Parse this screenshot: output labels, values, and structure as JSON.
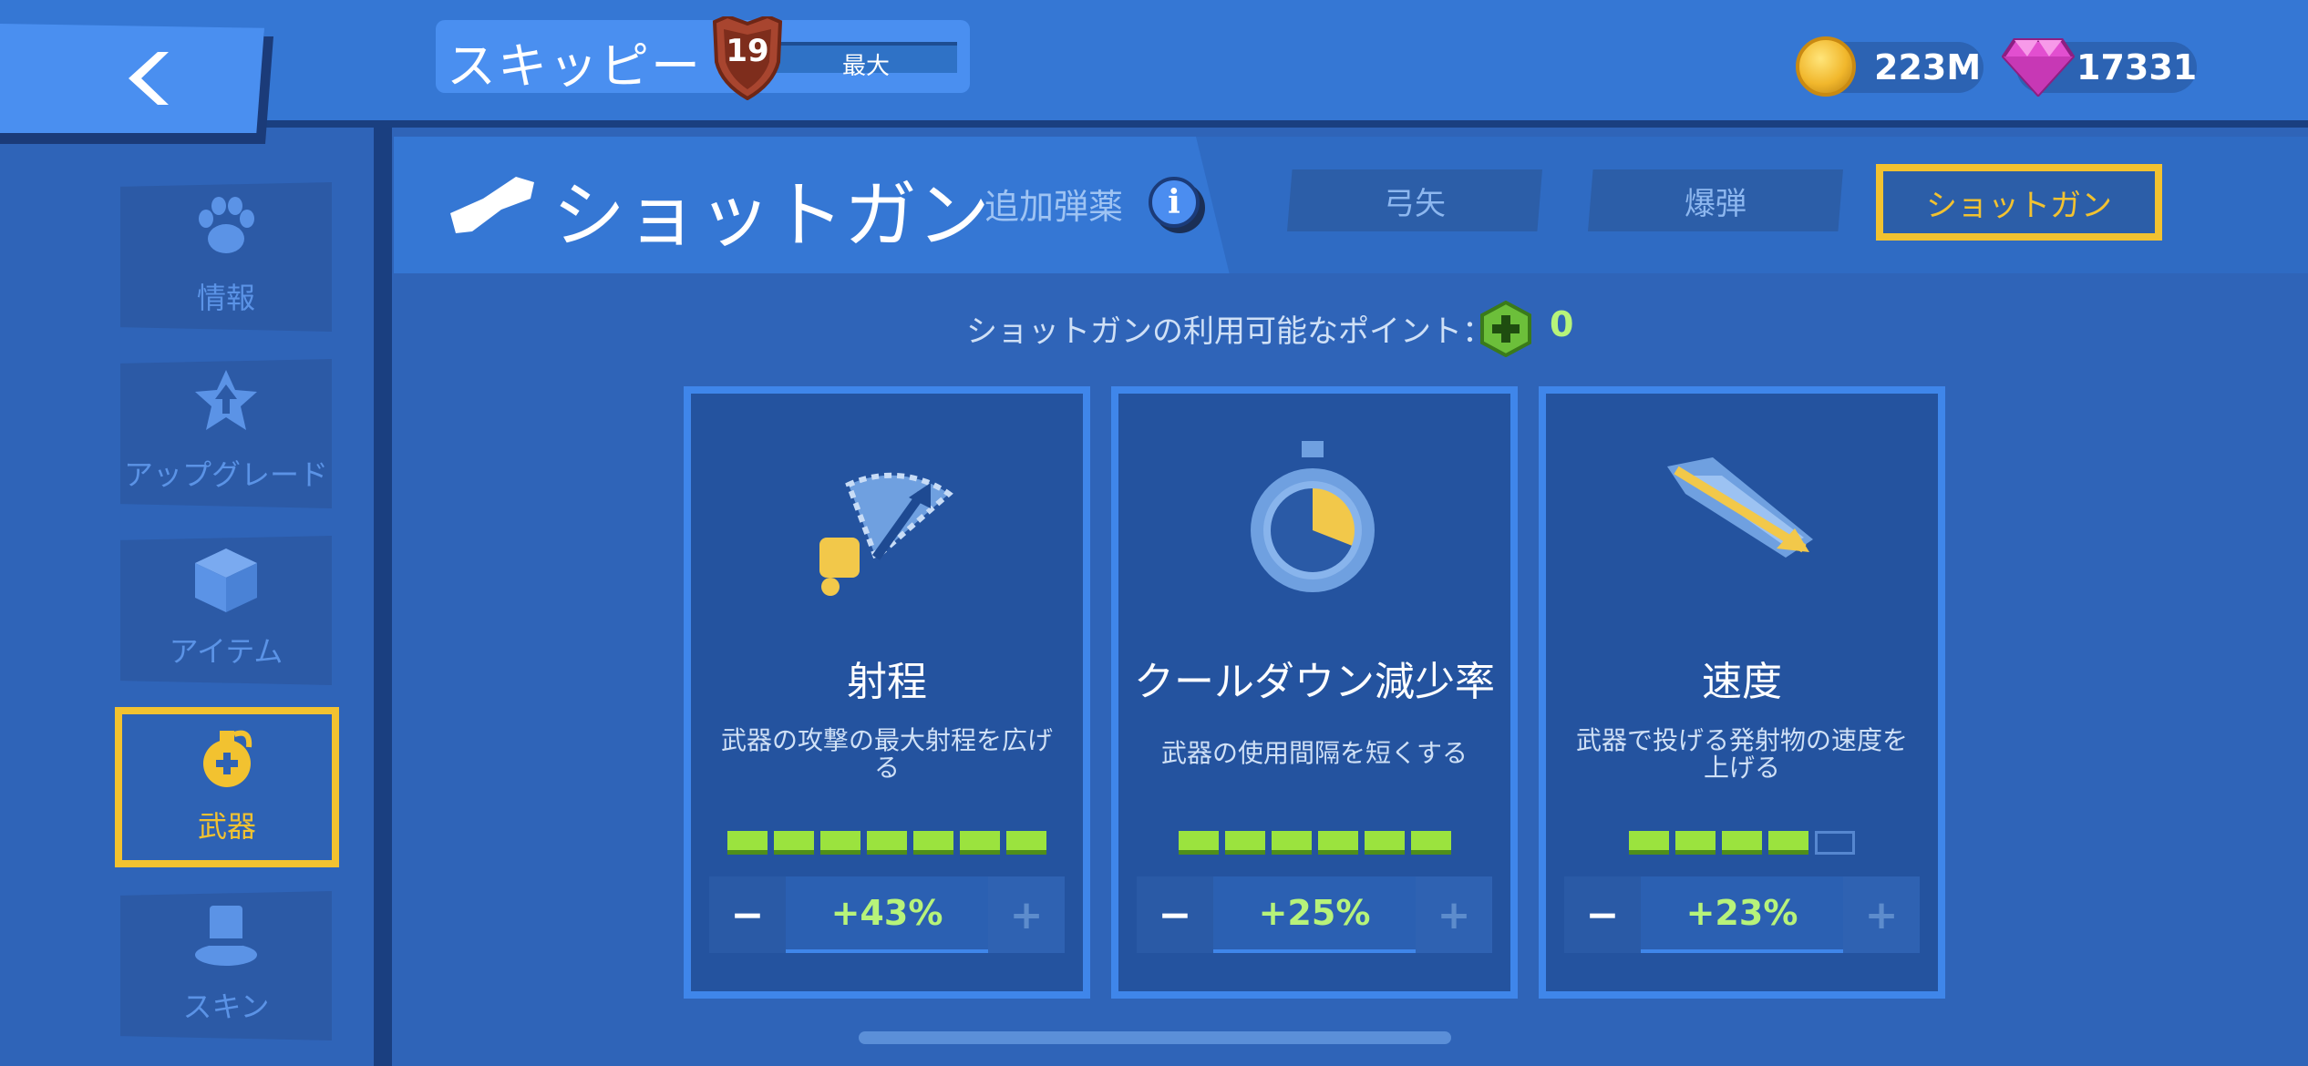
{
  "header": {
    "player_name": "スキッピー",
    "rank_level": "19",
    "rank_status": "最大",
    "coins": "223M",
    "gems": "17331"
  },
  "sidebar": {
    "items": [
      {
        "label": "情報",
        "icon": "paw-icon"
      },
      {
        "label": "アップグレード",
        "icon": "upgrade-star-icon"
      },
      {
        "label": "アイテム",
        "icon": "cube-icon"
      },
      {
        "label": "武器",
        "icon": "grenade-icon",
        "active": true
      },
      {
        "label": "スキン",
        "icon": "top-hat-icon"
      }
    ]
  },
  "weapon": {
    "title": "ショットガン",
    "subtitle": "追加弾薬",
    "tabs": [
      "弓矢",
      "爆弾",
      "ショットガン"
    ],
    "active_tab": "ショットガン",
    "points_label": "ショットガンの利用可能なポイント：",
    "points_value": "0"
  },
  "cards": [
    {
      "title": "射程",
      "description": "武器の攻撃の最大射程を広げる",
      "level": 7,
      "max_level": 7,
      "value": "+43%",
      "icon": "range-icon"
    },
    {
      "title": "クールダウン減少率",
      "description": "武器の使用間隔を短くする",
      "level": 6,
      "max_level": 6,
      "value": "+25%",
      "icon": "stopwatch-icon"
    },
    {
      "title": "速度",
      "description": "武器で投げる発射物の速度を上げる",
      "level": 4,
      "max_level": 5,
      "value": "+23%",
      "icon": "speed-arrow-icon"
    }
  ],
  "stepper": {
    "minus": "−",
    "plus": "+"
  },
  "colors": {
    "accent": "#f2c230",
    "positive": "#b7f37a",
    "panel": "#24539f",
    "background": "#2f64b8"
  }
}
